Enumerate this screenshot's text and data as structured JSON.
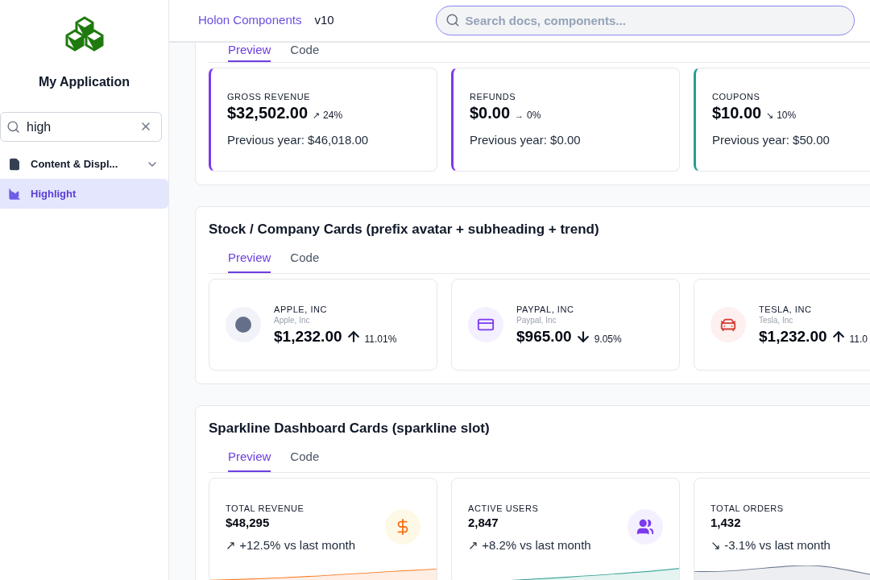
{
  "sidebar": {
    "app_name": "My Application",
    "search": {
      "value": "high"
    },
    "items": [
      {
        "label": "Content & Displ...",
        "kind": "group",
        "selected": false,
        "expanded": true
      },
      {
        "label": "Highlight",
        "kind": "page",
        "selected": true
      }
    ]
  },
  "header": {
    "title": "Holon Components",
    "version": "v10",
    "search": {
      "placeholder": "Search docs, components..."
    }
  },
  "sections": [
    {
      "kind": "summary",
      "tabs": [
        {
          "label": "Preview",
          "selected": true
        },
        {
          "label": "Code",
          "selected": false
        }
      ],
      "cards": [
        {
          "label": "GROSS REVENUE",
          "value": "$32,502.00",
          "arrow": "↗",
          "change": "24%",
          "note": "Previous year: $46,018.00",
          "color": "#7c3aed"
        },
        {
          "label": "REFUNDS",
          "value": "$0.00",
          "arrow": "→",
          "change": "0%",
          "note": "Previous year: $0.00",
          "color": "#7c3aed"
        },
        {
          "label": "COUPONS",
          "value": "$10.00",
          "arrow": "↘",
          "change": "10%",
          "note": "Previous year: $50.00",
          "color": "#2a9d8f"
        }
      ]
    },
    {
      "kind": "stock",
      "title": "Stock / Company Cards (prefix avatar + subheading + trend)",
      "tabs": [
        {
          "label": "Preview",
          "selected": true
        },
        {
          "label": "Code",
          "selected": false
        }
      ],
      "cards": [
        {
          "label": "APPLE, INC",
          "subheading": "Apple, Inc",
          "value": "$1,232.00",
          "kind": "up",
          "change": "11.01%"
        },
        {
          "label": "PAYPAL, INC",
          "subheading": "Paypal, Inc",
          "value": "$965.00",
          "kind": "down",
          "change": "9.05%"
        },
        {
          "label": "TESLA, INC",
          "subheading": "Tesla, Inc",
          "value": "$1,232.00",
          "kind": "up",
          "change": "11.0"
        }
      ]
    },
    {
      "kind": "sparkline",
      "title": "Sparkline Dashboard Cards (sparkline slot)",
      "tabs": [
        {
          "label": "Preview",
          "selected": true
        },
        {
          "label": "Code",
          "selected": false
        }
      ],
      "cards": [
        {
          "label": "TOTAL REVENUE",
          "value": "$48,295",
          "change": "↗ +12.5% vs last month",
          "color": "#f97316"
        },
        {
          "label": "ACTIVE USERS",
          "value": "2,847",
          "change": "↗ +8.2% vs last month",
          "color": "#2a9d8f"
        },
        {
          "label": "TOTAL ORDERS",
          "value": "1,432",
          "change": "↘ -3.1% vs last month",
          "color": "#64748b"
        }
      ]
    }
  ]
}
